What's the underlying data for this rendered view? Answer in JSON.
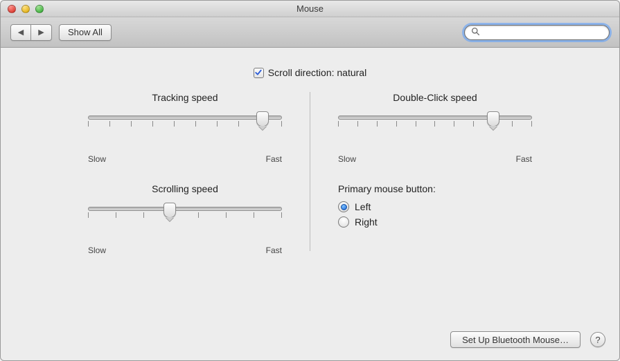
{
  "window": {
    "title": "Mouse"
  },
  "toolbar": {
    "show_all": "Show All",
    "search_placeholder": ""
  },
  "scroll_direction": {
    "label": "Scroll direction: natural",
    "checked": true
  },
  "sliders": {
    "tracking": {
      "title": "Tracking speed",
      "min_label": "Slow",
      "max_label": "Fast",
      "value": 90,
      "ticks": 10
    },
    "scrolling": {
      "title": "Scrolling speed",
      "min_label": "Slow",
      "max_label": "Fast",
      "value": 42,
      "ticks": 8
    },
    "double_click": {
      "title": "Double-Click speed",
      "min_label": "Slow",
      "max_label": "Fast",
      "value": 80,
      "ticks": 11
    }
  },
  "primary_button": {
    "title": "Primary mouse button:",
    "options": {
      "left": "Left",
      "right": "Right"
    },
    "selected": "left"
  },
  "footer": {
    "bluetooth": "Set Up Bluetooth Mouse…",
    "help": "?"
  }
}
